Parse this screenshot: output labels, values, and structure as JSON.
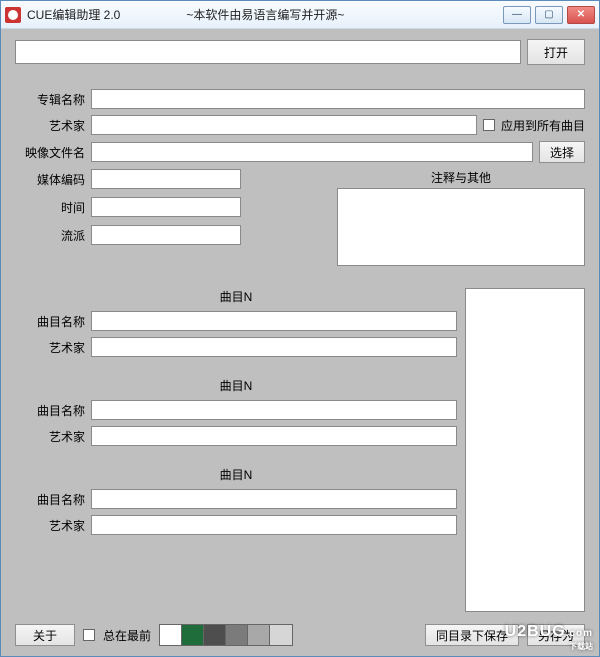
{
  "titlebar": {
    "title": "CUE编辑助理 2.0",
    "subtitle": "~本软件由易语言编写并开源~"
  },
  "open": {
    "button": "打开"
  },
  "labels": {
    "album_name": "专辑名称",
    "artist": "艺术家",
    "image_file": "映像文件名",
    "media_enc": "媒体编码",
    "time": "时间",
    "genre": "流派",
    "notes": "注释与其他",
    "select": "选择",
    "apply_all": "应用到所有曲目"
  },
  "tracks": [
    {
      "header": "曲目N",
      "name_label": "曲目名称",
      "artist_label": "艺术家"
    },
    {
      "header": "曲目N",
      "name_label": "曲目名称",
      "artist_label": "艺术家"
    },
    {
      "header": "曲目N",
      "name_label": "曲目名称",
      "artist_label": "艺术家"
    }
  ],
  "bottom": {
    "about": "关于",
    "always_on_top": "总在最前",
    "save_same_dir": "同目录下保存",
    "save_as": "另存为"
  },
  "swatches": [
    "#ffffff",
    "#1e6d3a",
    "#4e4e4e",
    "#7b7b7b",
    "#a8a8a8",
    "#d6d6d6"
  ],
  "watermark": {
    "main": "U2BUG",
    "sub": "下载站",
    "ext": ".com"
  }
}
